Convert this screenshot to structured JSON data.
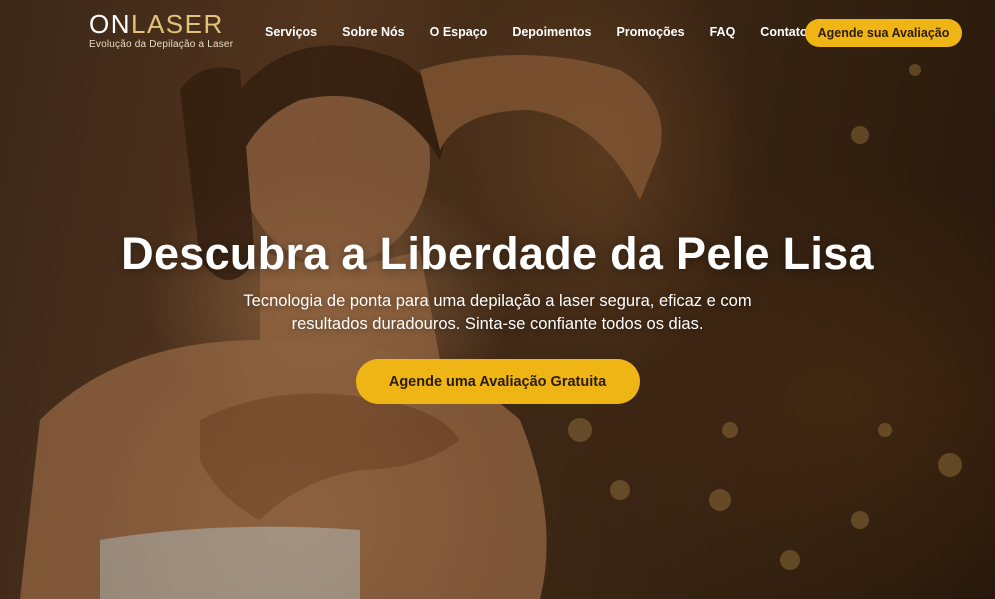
{
  "brand": {
    "logo_part1": "ON",
    "logo_part2": "LASER",
    "tagline": "Evolução da Depilação a Laser",
    "accent": "#efb514",
    "logo_gold": "#e3c27a"
  },
  "nav": {
    "items": [
      {
        "label": "Serviços"
      },
      {
        "label": "Sobre Nós"
      },
      {
        "label": "O Espaço"
      },
      {
        "label": "Depoimentos"
      },
      {
        "label": "Promoções"
      },
      {
        "label": "FAQ"
      },
      {
        "label": "Contato"
      }
    ],
    "cta_label": "Agende sua Avaliação"
  },
  "hero": {
    "headline": "Descubra a Liberdade da Pele Lisa",
    "subtitle": "Tecnologia de ponta para uma depilação a laser segura, eficaz e com resultados duradouros. Sinta-se confiante todos os dias.",
    "cta_label": "Agende uma Avaliação Gratuita"
  }
}
